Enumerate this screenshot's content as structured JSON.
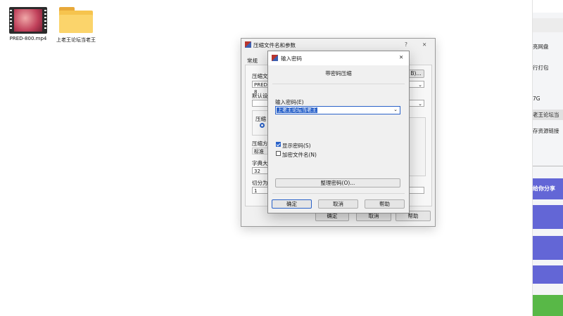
{
  "desktop": {
    "icons": [
      {
        "label": "PRED-800.mp4",
        "kind": "video-file-icon"
      },
      {
        "label": "上老王论坛当老王",
        "kind": "folder-icon"
      }
    ]
  },
  "right_panel": {
    "items": [
      "亮网盘",
      "行打包",
      "7G",
      "老王论坛当",
      "存资源链接"
    ],
    "share_label": "给你分享",
    "colors": {
      "blue": "#6366d6",
      "green": "#58b847"
    }
  },
  "outer_dialog": {
    "title": "压缩文件名和参数",
    "help_icon": "?",
    "close_icon": "✕",
    "tab_general": "常规",
    "archive_name_label": "压缩文",
    "archive_name_value": "PRED-8",
    "browse_button": "B)...",
    "default_label": "默认设",
    "format_label": "压缩",
    "method_label": "压缩方",
    "method_value": "标准",
    "dict_label": "字典大",
    "dict_value": "32",
    "split_label": "切分为",
    "split_value": "1",
    "ok": "确定",
    "cancel": "取消",
    "help": "帮助"
  },
  "password_dialog": {
    "title": "输入密码",
    "heading": "带密码压缩",
    "input_label": "输入密码(E)",
    "input_value": "上老王论坛当老王",
    "show_password": {
      "label": "显示密码(S)",
      "checked": true
    },
    "encrypt_names": {
      "label": "加密文件名(N)",
      "checked": false
    },
    "organize_button": "整理密码(O)...",
    "ok": "确定",
    "cancel": "取消",
    "help": "帮助",
    "close_icon": "✕"
  }
}
